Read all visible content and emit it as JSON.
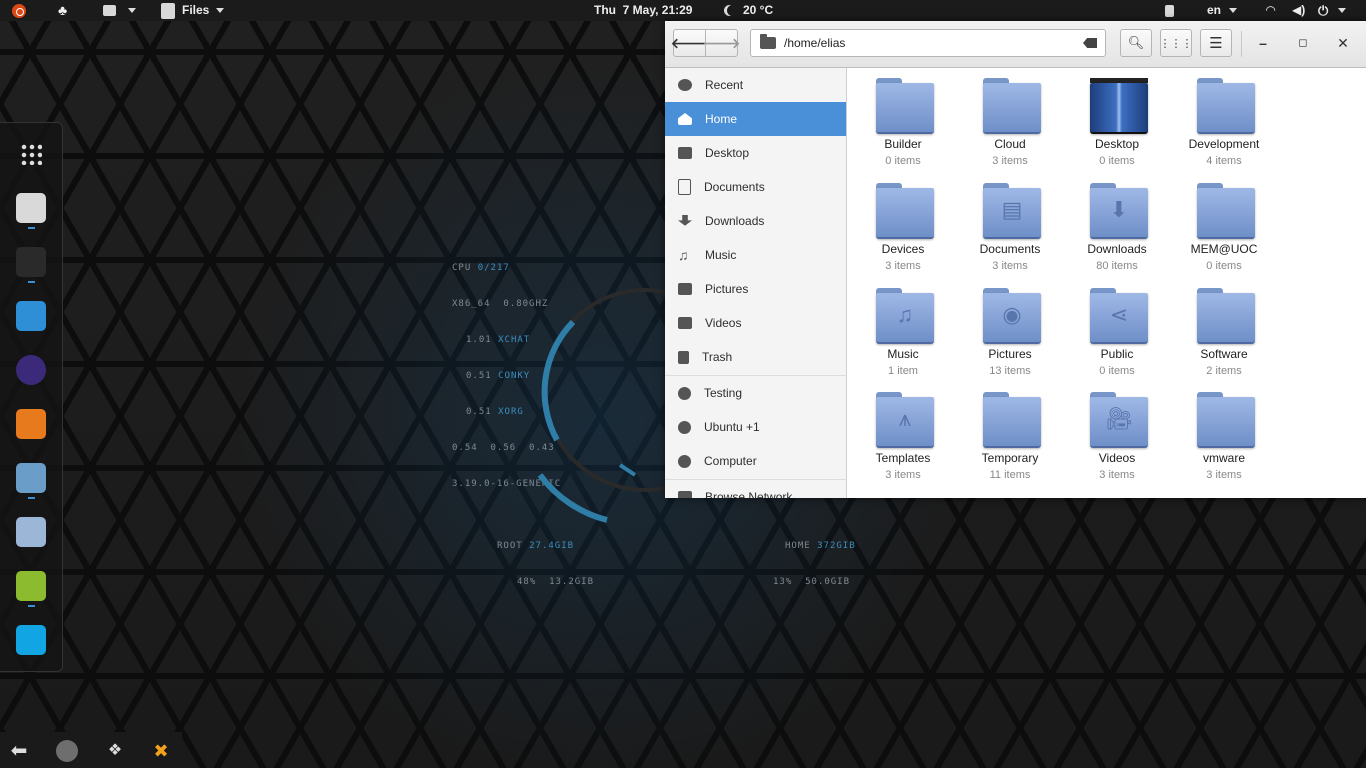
{
  "top_panel": {
    "app_name": "Files",
    "clock": "Thu  7 May, 21:29",
    "weather": "20 °C",
    "keyboard_layout": "en"
  },
  "conky": {
    "cpu_label": "CPU",
    "cpu_value": "0/217",
    "arch_label": "X86_64",
    "arch_value": "0.80GHZ",
    "procs": [
      {
        "load": "1.01",
        "name": "XCHAT"
      },
      {
        "load": "0.51",
        "name": "CONKY"
      },
      {
        "load": "0.51",
        "name": "XORG"
      }
    ],
    "loadavg": "0.54  0.56  0.43",
    "kernel": "3.19.0-16-GENERIC",
    "root_label": "ROOT",
    "root_size": "27.4GIB",
    "root_usage": "48%  13.2GIB",
    "home_label": "HOME",
    "home_size": "372GIB",
    "home_usage": "13%  50.0GIB"
  },
  "file_manager": {
    "path": "/home/elias",
    "sidebar": [
      {
        "label": "Recent",
        "icon": "clock-icon",
        "active": false
      },
      {
        "label": "Home",
        "icon": "home-icon",
        "active": true
      },
      {
        "label": "Desktop",
        "icon": "desktop-icon",
        "active": false
      },
      {
        "label": "Documents",
        "icon": "document-icon",
        "active": false
      },
      {
        "label": "Downloads",
        "icon": "download-icon",
        "active": false
      },
      {
        "label": "Music",
        "icon": "music-icon",
        "active": false
      },
      {
        "label": "Pictures",
        "icon": "camera-icon",
        "active": false
      },
      {
        "label": "Videos",
        "icon": "video-icon",
        "active": false
      },
      {
        "label": "Trash",
        "icon": "trash-icon",
        "active": false
      },
      {
        "label": "Testing",
        "icon": "drive-icon",
        "active": false
      },
      {
        "label": "Ubuntu +1",
        "icon": "drive-icon",
        "active": false
      },
      {
        "label": "Computer",
        "icon": "drive-icon",
        "active": false
      },
      {
        "label": "Browse Network",
        "icon": "network-icon",
        "active": false
      }
    ],
    "items": [
      {
        "name": "Builder",
        "count": "0 items",
        "icon": "folder-icon"
      },
      {
        "name": "Cloud",
        "count": "3 items",
        "icon": "folder-icon"
      },
      {
        "name": "Desktop",
        "count": "0 items",
        "icon": "desktop-folder-icon"
      },
      {
        "name": "Development",
        "count": "4 items",
        "icon": "folder-icon"
      },
      {
        "name": "Devices",
        "count": "3 items",
        "icon": "folder-icon"
      },
      {
        "name": "Documents",
        "count": "3 items",
        "icon": "documents-folder-icon"
      },
      {
        "name": "Downloads",
        "count": "80 items",
        "icon": "downloads-folder-icon"
      },
      {
        "name": "MEM@UOC",
        "count": "0 items",
        "icon": "folder-icon"
      },
      {
        "name": "Music",
        "count": "1 item",
        "icon": "music-folder-icon"
      },
      {
        "name": "Pictures",
        "count": "13 items",
        "icon": "pictures-folder-icon"
      },
      {
        "name": "Public",
        "count": "0 items",
        "icon": "public-folder-icon"
      },
      {
        "name": "Software",
        "count": "2 items",
        "icon": "folder-icon"
      },
      {
        "name": "Templates",
        "count": "3 items",
        "icon": "templates-folder-icon"
      },
      {
        "name": "Temporary",
        "count": "11 items",
        "icon": "folder-icon"
      },
      {
        "name": "Videos",
        "count": "3 items",
        "icon": "videos-folder-icon"
      },
      {
        "name": "vmware",
        "count": "3 items",
        "icon": "folder-icon"
      }
    ]
  },
  "dock": [
    {
      "icon": "app-grid-icon"
    },
    {
      "icon": "file-cabinet-icon",
      "color": "#d9d9d9"
    },
    {
      "icon": "terminal-icon",
      "color": "#2a2a2a"
    },
    {
      "icon": "virtualbox-icon",
      "color": "#2f8fd6"
    },
    {
      "icon": "eclipse-icon",
      "color": "#3b2a7a"
    },
    {
      "icon": "matlab-icon",
      "color": "#e87a1e"
    },
    {
      "icon": "remote-desktop-icon",
      "color": "#6a9ec9"
    },
    {
      "icon": "mail-client-icon",
      "color": "#9bb6d6"
    },
    {
      "icon": "hexchat-icon",
      "color": "#8dbb2f"
    },
    {
      "icon": "skype-icon",
      "color": "#12a5e3"
    }
  ],
  "tray": [
    {
      "icon": "back-arrow-icon"
    },
    {
      "icon": "update-cloud-icon"
    },
    {
      "icon": "dropbox-icon"
    },
    {
      "icon": "hexchat-tray-icon"
    }
  ],
  "colors": {
    "accent": "#4a90d9",
    "folder": "#7f9fd6",
    "conky_highlight": "#3c8fbf"
  }
}
